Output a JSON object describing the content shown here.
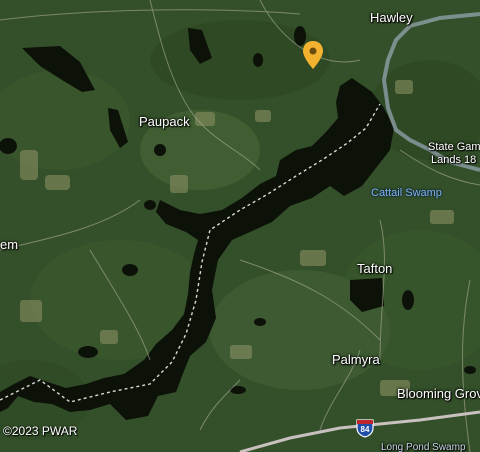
{
  "map": {
    "copyright": "©2023 PWAR",
    "highway_shield": "84",
    "marker_icon": "map-pin-icon",
    "marker_color": "#f2b230",
    "water_color": "#0d1209",
    "labels": {
      "hawley": "Hawley",
      "paupack": "Paupack",
      "state_game_lands_line1": "State Gam",
      "state_game_lands_line2": "Lands 18",
      "cattail_swamp": "Cattail Swamp",
      "tafton": "Tafton",
      "palmyra": "Palmyra",
      "blooming_grove": "Blooming Grov",
      "west_edge": "em",
      "long_pond_swamp": "Long Pond Swamp"
    }
  }
}
